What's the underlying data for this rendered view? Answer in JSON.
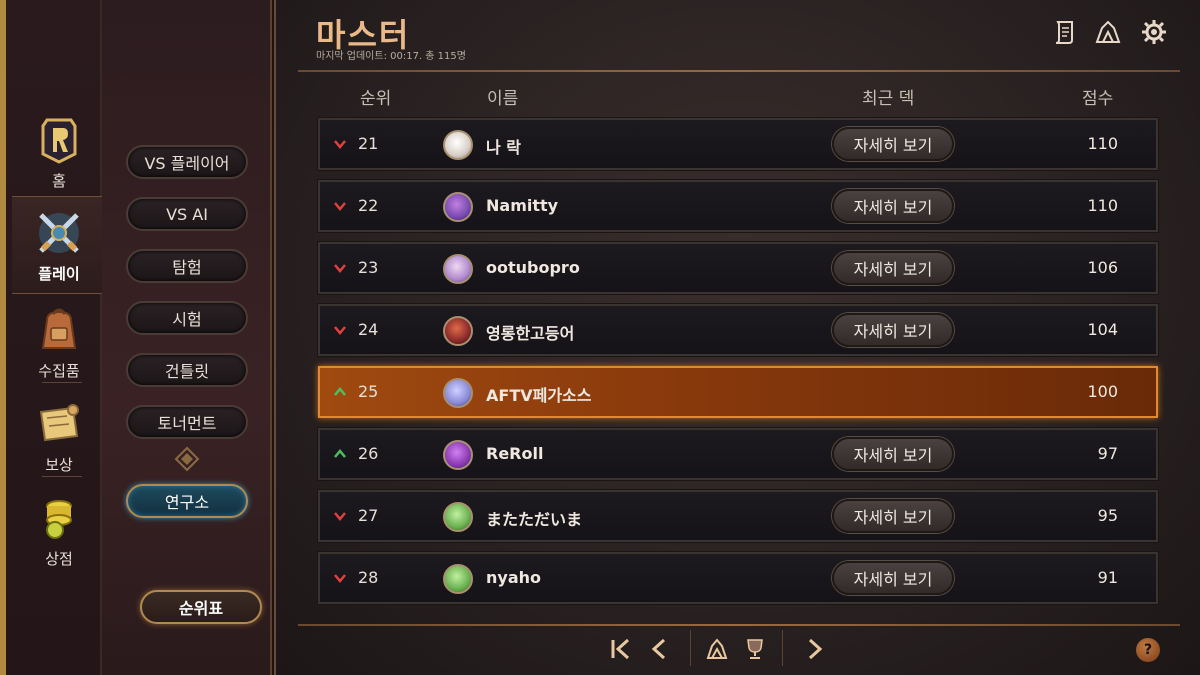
{
  "nav": {
    "items": [
      {
        "label": "홈",
        "icon": "legends-logo-icon"
      },
      {
        "label": "플레이",
        "icon": "crossed-swords-icon"
      },
      {
        "label": "수집품",
        "icon": "backpack-icon"
      },
      {
        "label": "보상",
        "icon": "scroll-map-icon"
      },
      {
        "label": "상점",
        "icon": "coins-icon"
      }
    ]
  },
  "modes": {
    "items": [
      "VS 플레이어",
      "VS AI",
      "탐험",
      "시험",
      "건틀릿",
      "토너먼트",
      "연구소"
    ],
    "leaderboard": "순위표"
  },
  "header": {
    "title": "마스터",
    "subtitle": "마지막 업데이트: 00:17. 총 115명"
  },
  "columns": {
    "rank": "순위",
    "name": "이름",
    "deck": "최근 덱",
    "score": "점수"
  },
  "rows": [
    {
      "trend": "down",
      "rank": "21",
      "name": "나 락",
      "deck": "자세히 보기",
      "score": "110",
      "avatar_color": "#d8d0c8"
    },
    {
      "trend": "down",
      "rank": "22",
      "name": "Namitty",
      "deck": "자세히 보기",
      "score": "110",
      "avatar_color": "#7a4ab0"
    },
    {
      "trend": "down",
      "rank": "23",
      "name": "ootubopro",
      "deck": "자세히 보기",
      "score": "106",
      "avatar_color": "#b08ad0"
    },
    {
      "trend": "down",
      "rank": "24",
      "name": "영롱한고등어",
      "deck": "자세히 보기",
      "score": "104",
      "avatar_color": "#8a2a2a"
    },
    {
      "trend": "up",
      "rank": "25",
      "name": "AFTV페가소스",
      "deck": "",
      "score": "100",
      "avatar_color": "#8a8ad8",
      "me": true
    },
    {
      "trend": "up",
      "rank": "26",
      "name": "ReRoll",
      "deck": "자세히 보기",
      "score": "97",
      "avatar_color": "#8a3ab0"
    },
    {
      "trend": "down",
      "rank": "27",
      "name": "またただいま",
      "deck": "자세히 보기",
      "score": "95",
      "avatar_color": "#6ab050"
    },
    {
      "trend": "down",
      "rank": "28",
      "name": "nyaho",
      "deck": "자세히 보기",
      "score": "91",
      "avatar_color": "#6ab050"
    }
  ],
  "colors": {
    "accent": "#e9b98a",
    "highlight_row": "#a04a10",
    "trend_up": "#4ac060",
    "trend_down": "#e04040"
  },
  "help": "?"
}
